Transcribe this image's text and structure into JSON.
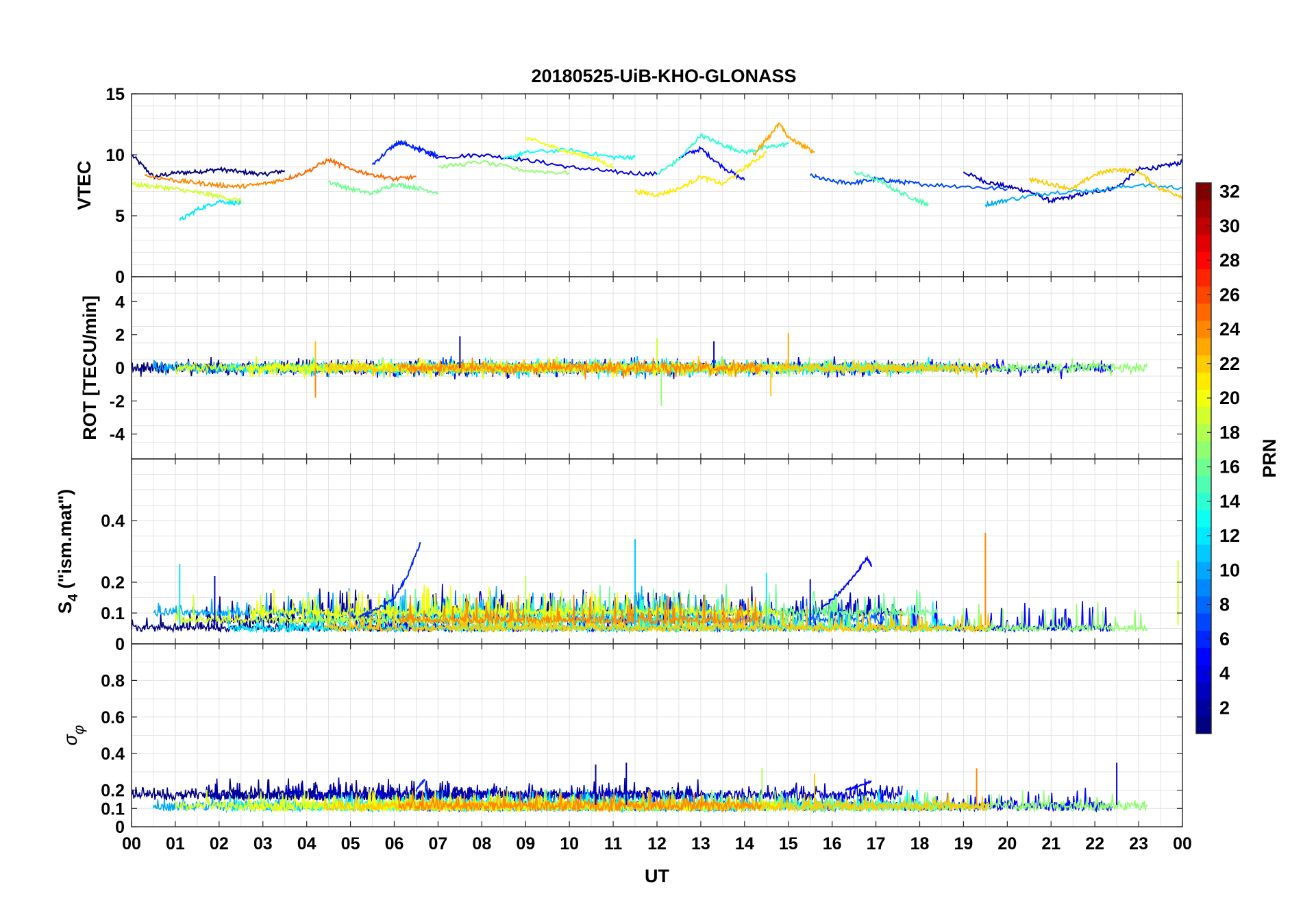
{
  "chart_data": {
    "type": "line",
    "title": "20180525-UiB-KHO-GLONASS",
    "xlabel": "UT",
    "x_ticks": [
      "00",
      "01",
      "02",
      "03",
      "04",
      "05",
      "06",
      "07",
      "08",
      "09",
      "10",
      "11",
      "12",
      "13",
      "14",
      "15",
      "16",
      "17",
      "18",
      "19",
      "20",
      "21",
      "22",
      "23",
      "00"
    ],
    "xlim_hours": [
      0,
      24
    ],
    "grid": true,
    "panels": [
      {
        "id": "vtec",
        "ylabel": "VTEC",
        "ylim": [
          0,
          15
        ],
        "yticks": [
          0,
          5,
          10,
          15
        ],
        "series": [
          {
            "prn": 1,
            "x": [
              0.0,
              0.5,
              1.0,
              1.5,
              2.0,
              2.5,
              3.0,
              3.5
            ],
            "y": [
              10.0,
              8.2,
              8.5,
              8.6,
              8.8,
              8.6,
              8.4,
              8.7
            ]
          },
          {
            "prn": 3,
            "x": [
              19.0,
              19.5,
              20.0,
              20.5,
              21.0,
              21.5,
              22.0,
              22.5,
              23.0,
              23.5,
              24.0
            ],
            "y": [
              8.6,
              7.8,
              7.4,
              7.0,
              6.2,
              6.6,
              7.0,
              7.3,
              8.8,
              9.0,
              9.4
            ]
          },
          {
            "prn": 4,
            "x": [
              6.5,
              7.0,
              8.0,
              9.0,
              10.0,
              11.0,
              12.0
            ],
            "y": [
              10.6,
              9.8,
              10.0,
              9.6,
              9.0,
              8.6,
              8.4
            ]
          },
          {
            "prn": 5,
            "x": [
              12.5,
              13.0,
              13.5,
              14.0
            ],
            "y": [
              9.8,
              10.5,
              9.0,
              7.9
            ]
          },
          {
            "prn": 6,
            "x": [
              5.5,
              6.0,
              6.2,
              6.5,
              7.0
            ],
            "y": [
              9.2,
              10.8,
              11.0,
              10.5,
              9.9
            ]
          },
          {
            "prn": 7,
            "x": [
              15.5,
              16.0,
              16.5,
              17.0,
              17.5,
              18.0,
              19.0,
              20.0
            ],
            "y": [
              8.3,
              7.8,
              7.7,
              8.0,
              7.8,
              7.6,
              7.4,
              7.2
            ]
          },
          {
            "prn": 10,
            "x": [
              19.5,
              20.0,
              21.0,
              22.0,
              23.0,
              24.0
            ],
            "y": [
              5.9,
              6.3,
              6.9,
              7.1,
              7.5,
              7.3
            ]
          },
          {
            "prn": 12,
            "x": [
              1.1,
              1.5,
              2.0,
              2.5
            ],
            "y": [
              4.6,
              5.5,
              6.2,
              6.0
            ]
          },
          {
            "prn": 13,
            "x": [
              8.5,
              9.0,
              10.0,
              11.0,
              11.5
            ],
            "y": [
              9.6,
              10.2,
              10.4,
              9.8,
              9.8
            ]
          },
          {
            "prn": 14,
            "x": [
              12.0,
              12.5,
              13.0,
              13.5,
              14.0,
              14.5,
              15.0
            ],
            "y": [
              8.4,
              9.6,
              11.6,
              10.8,
              10.2,
              10.6,
              10.9
            ]
          },
          {
            "prn": 15,
            "x": [
              16.5,
              17.0,
              17.5,
              18.0,
              18.2
            ],
            "y": [
              8.6,
              8.0,
              7.0,
              6.2,
              5.9
            ]
          },
          {
            "prn": 16,
            "x": [
              4.5,
              5.0,
              5.5,
              6.0,
              6.5,
              7.0
            ],
            "y": [
              7.8,
              7.2,
              6.8,
              7.6,
              7.3,
              6.9
            ]
          },
          {
            "prn": 17,
            "x": [
              7.0,
              8.0,
              9.0,
              10.0
            ],
            "y": [
              9.0,
              9.4,
              8.7,
              8.5
            ]
          },
          {
            "prn": 19,
            "x": [
              0.0,
              0.5,
              1.0,
              1.5,
              2.0,
              2.5
            ],
            "y": [
              7.6,
              7.4,
              7.2,
              6.9,
              6.6,
              6.2
            ]
          },
          {
            "prn": 20,
            "x": [
              9.0,
              9.5,
              10.0,
              10.5,
              11.0
            ],
            "y": [
              11.4,
              10.8,
              10.2,
              9.8,
              9.0
            ]
          },
          {
            "prn": 21,
            "x": [
              11.5,
              12.0,
              12.5,
              13.0,
              13.5,
              14.0,
              14.5
            ],
            "y": [
              7.0,
              6.7,
              7.2,
              8.2,
              7.6,
              8.9,
              10.2
            ]
          },
          {
            "prn": 22,
            "x": [
              20.5,
              21.0,
              21.5,
              22.0,
              22.5,
              23.0,
              23.5,
              24.0
            ],
            "y": [
              8.0,
              7.6,
              7.2,
              8.4,
              8.8,
              8.6,
              7.2,
              6.6
            ]
          },
          {
            "prn": 23,
            "x": [
              14.2,
              14.5,
              14.8,
              15.0,
              15.3,
              15.6
            ],
            "y": [
              10.0,
              11.2,
              12.6,
              11.4,
              10.8,
              10.2
            ]
          },
          {
            "prn": 24,
            "x": [
              0.3,
              1.0,
              1.5,
              2.0,
              2.5,
              3.0,
              3.5
            ],
            "y": [
              8.3,
              7.9,
              7.7,
              7.5,
              7.4,
              7.6,
              8.0
            ]
          },
          {
            "prn": 25,
            "x": [
              3.5,
              4.0,
              4.5,
              5.0,
              5.5,
              6.0,
              6.5
            ],
            "y": [
              8.0,
              8.6,
              9.6,
              8.8,
              8.4,
              8.0,
              8.2
            ]
          }
        ]
      },
      {
        "id": "rot",
        "ylabel": "ROT [TECU/min]",
        "ylim": [
          -5.5,
          5.5
        ],
        "yticks": [
          -4,
          -2,
          0,
          2,
          4
        ],
        "peaks": [
          {
            "prn": 24,
            "x": 4.2,
            "y": -1.8
          },
          {
            "prn": 22,
            "x": 4.2,
            "y": 1.6
          },
          {
            "prn": 2,
            "x": 7.5,
            "y": 1.9
          },
          {
            "prn": 17,
            "x": 12.1,
            "y": -2.3
          },
          {
            "prn": 19,
            "x": 12.0,
            "y": 1.8
          },
          {
            "prn": 23,
            "x": 15.0,
            "y": 2.1
          },
          {
            "prn": 22,
            "x": 14.6,
            "y": -1.7
          },
          {
            "prn": 3,
            "x": 13.3,
            "y": 1.6
          }
        ]
      },
      {
        "id": "s4",
        "ylabel": "S4 (\"ism.mat\")",
        "ylim": [
          0,
          0.6
        ],
        "yticks": [
          0,
          0.1,
          0.2,
          0.4
        ],
        "series": [
          {
            "prn": 6,
            "x": [
              5.2,
              5.6,
              6.0,
              6.3,
              6.6
            ],
            "y": [
              0.09,
              0.11,
              0.15,
              0.22,
              0.33
            ]
          },
          {
            "prn": 5,
            "x": [
              15.8,
              16.2,
              16.5,
              16.8,
              16.9
            ],
            "y": [
              0.12,
              0.17,
              0.22,
              0.28,
              0.25
            ]
          }
        ],
        "peaks": [
          {
            "prn": 24,
            "x": 19.5,
            "y": 0.36
          },
          {
            "prn": 11,
            "x": 11.5,
            "y": 0.34
          },
          {
            "prn": 19,
            "x": 23.9,
            "y": 0.27
          },
          {
            "prn": 12,
            "x": 1.1,
            "y": 0.26
          },
          {
            "prn": 3,
            "x": 1.9,
            "y": 0.22
          },
          {
            "prn": 12,
            "x": 14.5,
            "y": 0.23
          },
          {
            "prn": 4,
            "x": 15.5,
            "y": 0.21
          },
          {
            "prn": 18,
            "x": 9.0,
            "y": 0.22
          }
        ]
      },
      {
        "id": "sigma",
        "ylabel": "σφ",
        "ylim": [
          0,
          1
        ],
        "yticks": [
          0,
          0.1,
          0.2,
          0.4,
          0.6,
          0.8
        ],
        "series": [
          {
            "prn": 6,
            "x": [
              6.5,
              6.6,
              6.7
            ],
            "y": [
              0.2,
              0.23,
              0.26
            ]
          },
          {
            "prn": 5,
            "x": [
              16.3,
              16.6,
              16.9
            ],
            "y": [
              0.2,
              0.22,
              0.25
            ]
          }
        ],
        "peaks": [
          {
            "prn": 3,
            "x": 11.3,
            "y": 0.35
          },
          {
            "prn": 3,
            "x": 22.5,
            "y": 0.35
          },
          {
            "prn": 24,
            "x": 19.3,
            "y": 0.32
          },
          {
            "prn": 2,
            "x": 10.6,
            "y": 0.34
          },
          {
            "prn": 18,
            "x": 14.4,
            "y": 0.32
          },
          {
            "prn": 22,
            "x": 15.6,
            "y": 0.29
          }
        ]
      }
    ],
    "colorbar": {
      "label": "PRN",
      "colormap": "jet",
      "range": [
        1,
        32
      ],
      "ticks": [
        2,
        4,
        6,
        8,
        10,
        12,
        14,
        16,
        18,
        20,
        22,
        24,
        26,
        28,
        30,
        32
      ]
    }
  }
}
